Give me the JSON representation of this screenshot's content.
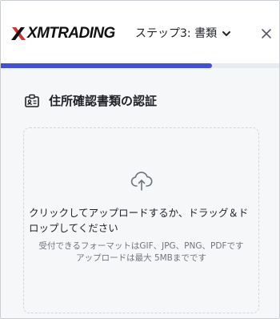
{
  "header": {
    "brand": "XMTRADING",
    "step_label": "ステップ3: 書類",
    "brand_color": "#111111",
    "brand_accent_color": "#d6312f"
  },
  "progress": {
    "value_fraction": 0.76,
    "color": "#4150dc"
  },
  "section": {
    "title": "住所確認書類の認証",
    "icon": "id-card-icon"
  },
  "upload": {
    "icon": "cloud-upload-icon",
    "instruction": "クリックしてアップロードするか、ドラッグ＆ドロップしてください",
    "formats_note": "受付できるフォーマットはGIF、JPG、PNG、PDFです",
    "size_note": "アップロードは最大 5MBまでです"
  },
  "icons": {
    "chevron": "chevron-down-icon",
    "close": "close-icon"
  }
}
